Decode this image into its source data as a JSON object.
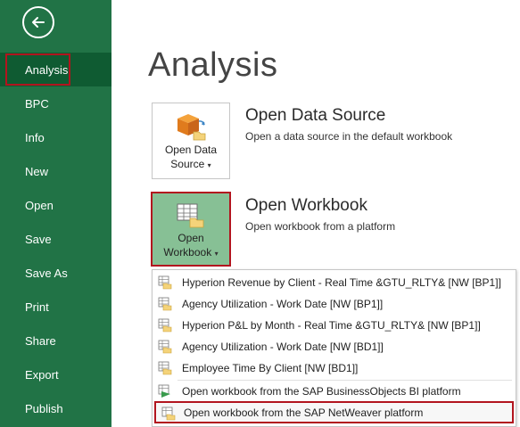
{
  "sidebar": {
    "back_icon": "arrow-left-circle-icon",
    "items": [
      {
        "label": "Analysis",
        "selected": true
      },
      {
        "label": "BPC"
      },
      {
        "label": "Info"
      },
      {
        "label": "New"
      },
      {
        "label": "Open"
      },
      {
        "label": "Save"
      },
      {
        "label": "Save As"
      },
      {
        "label": "Print"
      },
      {
        "label": "Share"
      },
      {
        "label": "Export"
      },
      {
        "label": "Publish"
      }
    ]
  },
  "main": {
    "title": "Analysis",
    "open_data_source": {
      "tile_line1": "Open Data",
      "tile_line2": "Source",
      "caret": "▾",
      "heading": "Open Data Source",
      "description": "Open a data source in the default workbook",
      "icon": "cube-folder-icon"
    },
    "open_workbook": {
      "tile_line1": "Open",
      "tile_line2": "Workbook",
      "caret": "▾",
      "heading": "Open Workbook",
      "description": "Open workbook from a platform",
      "icon": "grid-folder-icon"
    },
    "menu": {
      "recent": [
        {
          "label": "Hyperion Revenue by Client - Real Time &GTU_RLTY& [NW [BP1]]"
        },
        {
          "label": "Agency Utilization - Work Date [NW [BP1]]"
        },
        {
          "label": "Hyperion P&L by Month - Real Time &GTU_RLTY& [NW [BP1]]"
        },
        {
          "label": "Agency Utilization - Work Date [NW [BD1]]"
        },
        {
          "label": "Employee Time By Client [NW [BD1]]"
        }
      ],
      "platforms": [
        {
          "label": "Open workbook from the SAP BusinessObjects BI platform"
        },
        {
          "label": "Open workbook from the SAP NetWeaver platform"
        }
      ]
    }
  },
  "colors": {
    "sidebar_bg": "#217346",
    "sidebar_selected": "#0f5b32",
    "highlight_outline": "#b2141e",
    "tile_active_bg": "#87c095"
  }
}
